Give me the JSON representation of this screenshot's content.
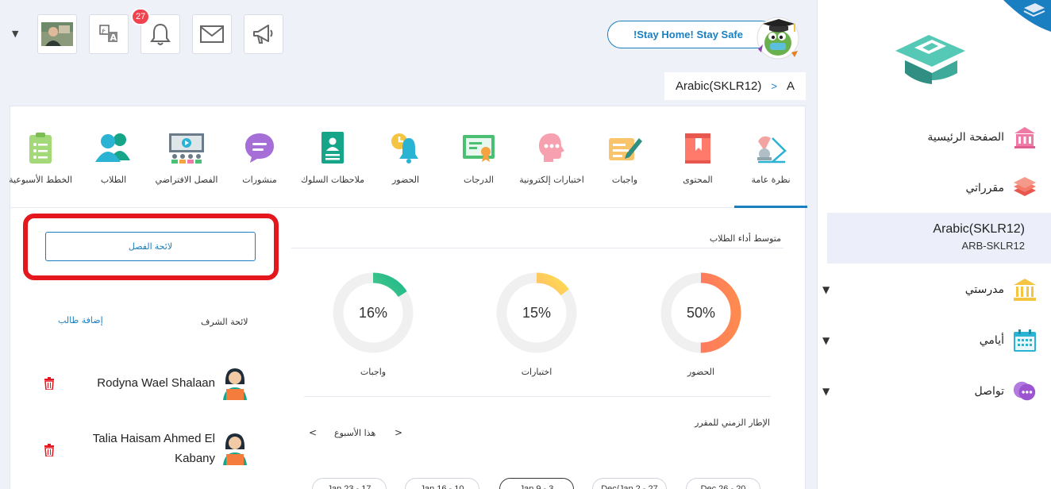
{
  "topbar": {
    "notification_count": "27",
    "stay_home_label": "!Stay Home! Stay Safe"
  },
  "breadcrumb": {
    "course": "Arabic(SKLR12)",
    "separator": ">",
    "section": "A"
  },
  "sidebar": {
    "home": "الصفحة الرئيسية",
    "my_courses": "مقرراتي",
    "course_name": "Arabic(SKLR12)",
    "course_code": "ARB-SKLR12",
    "my_school": "مدرستي",
    "my_days": "أيامي",
    "contact": "تواصل"
  },
  "tabs": [
    {
      "label": "نظرة عامة",
      "icon": "overview-icon",
      "active": true
    },
    {
      "label": "المحتوى",
      "icon": "book-icon"
    },
    {
      "label": "واجبات",
      "icon": "assignment-icon"
    },
    {
      "label": "اختبارات إلكترونية",
      "icon": "quiz-icon"
    },
    {
      "label": "الدرجات",
      "icon": "grades-icon"
    },
    {
      "label": "الحضور",
      "icon": "attendance-icon"
    },
    {
      "label": "ملاحظات السلوك",
      "icon": "behavior-icon"
    },
    {
      "label": "منشورات",
      "icon": "posts-icon"
    },
    {
      "label": "الفصل الافتراضي",
      "icon": "virtual-class-icon"
    },
    {
      "label": "الطلاب",
      "icon": "students-icon"
    },
    {
      "label": "الخطط الأسبوعية",
      "icon": "weekly-plan-icon"
    }
  ],
  "left_panel": {
    "class_list_button": "لائحة الفصل",
    "honor_list": "لائحة الشرف",
    "add_student": "إضافة طالب",
    "students": [
      {
        "name": "Rodyna Wael Shalaan"
      },
      {
        "name_line1": "Talia Haisam Ahmed El",
        "name_line2": "Kabany"
      }
    ]
  },
  "performance": {
    "title": "متوسط أداء الطلاب",
    "metrics": [
      {
        "label": "الحضور",
        "value": "50%",
        "fraction": 0.5,
        "color_a": "#ff6b6b",
        "color_b": "#ff8a50"
      },
      {
        "label": "اختبارات",
        "value": "15%",
        "fraction": 0.15,
        "color_a": "#ff7a9a",
        "color_b": "#ffe14d"
      },
      {
        "label": "واجبات",
        "value": "16%",
        "fraction": 0.16,
        "color_a": "#a8e08a",
        "color_b": "#17b88a"
      }
    ]
  },
  "timeline": {
    "title": "الإطار الزمني للمقرر",
    "this_week": "هذا الأسبوع",
    "prev": "<",
    "next": ">",
    "weeks": [
      "Jan 23 - 17",
      "Jan 16 - 10",
      "Jan 9 - 3",
      "Dec/Jan 2 - 27",
      "Dec 26 - 20"
    ]
  },
  "colors": {
    "primary": "#1a7fc1",
    "badge": "#f0434f",
    "highlight_box": "#e3171d"
  }
}
